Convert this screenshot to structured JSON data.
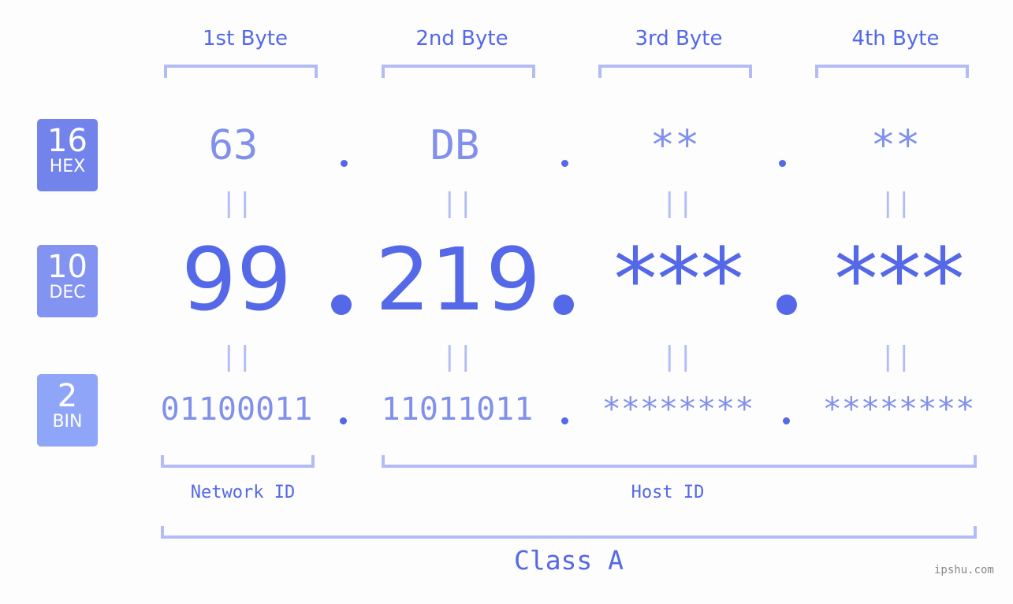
{
  "bytes": [
    {
      "label": "1st Byte",
      "hex": "63",
      "dec": "99",
      "bin": "01100011"
    },
    {
      "label": "2nd Byte",
      "hex": "DB",
      "dec": "219",
      "bin": "11011011"
    },
    {
      "label": "3rd Byte",
      "hex": "**",
      "dec": "***",
      "bin": "********"
    },
    {
      "label": "4th Byte",
      "hex": "**",
      "dec": "***",
      "bin": "********"
    }
  ],
  "badges": {
    "hex": {
      "num": "16",
      "label": "HEX",
      "color": "#7383ec"
    },
    "dec": {
      "num": "10",
      "label": "DEC",
      "color": "#8393f1"
    },
    "bin": {
      "num": "2",
      "label": "BIN",
      "color": "#8ea5f8"
    }
  },
  "equals_symbol": "||",
  "network_id_label": "Network ID",
  "host_id_label": "Host ID",
  "class_label": "Class A",
  "watermark": "ipshu.com",
  "colors": {
    "primary": "#5468e8",
    "secondary": "#8190ec",
    "bracket": "#b4bcf6",
    "background": "#fcfdfc"
  }
}
